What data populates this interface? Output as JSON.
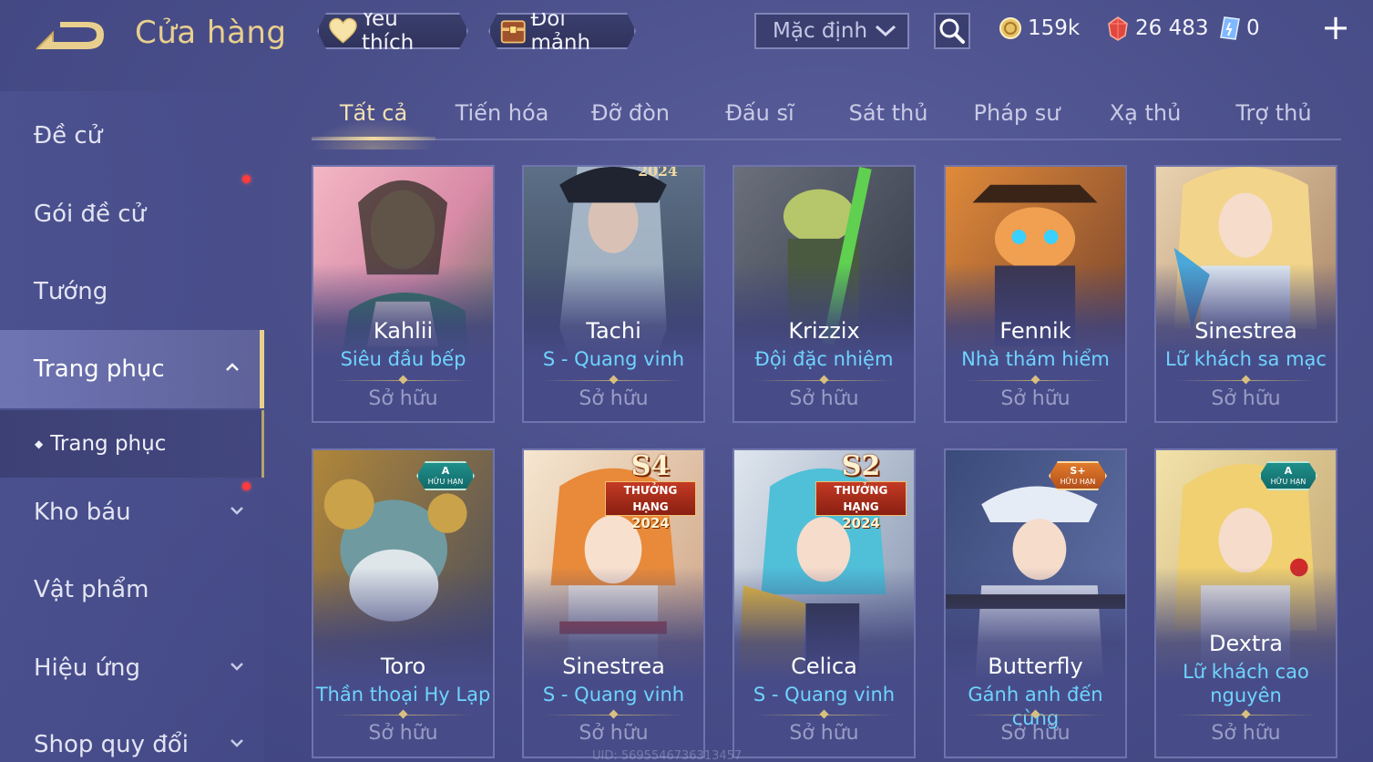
{
  "header": {
    "title": "Cửa hàng",
    "favorite_label": "Yêu thích",
    "exchange_label": "Đổi mảnh",
    "sort_value": "Mặc định",
    "currencies": {
      "gold": "159k",
      "gems": "26 483",
      "tickets": "0"
    }
  },
  "sidebar": {
    "items": [
      {
        "label": "Đề cử"
      },
      {
        "label": "Gói đề cử"
      },
      {
        "label": "Tướng"
      },
      {
        "label": "Trang phục"
      },
      {
        "label": "Trang phục"
      },
      {
        "label": "Kho báu"
      },
      {
        "label": "Vật phẩm"
      },
      {
        "label": "Hiệu ứng"
      },
      {
        "label": "Shop quy đổi"
      }
    ]
  },
  "tabs": [
    "Tất cả",
    "Tiến hóa",
    "Đỡ đòn",
    "Đấu sĩ",
    "Sát thủ",
    "Pháp sư",
    "Xạ thủ",
    "Trợ thủ"
  ],
  "cards": [
    {
      "hero": "Kahlii",
      "skin": "Siêu đầu bếp",
      "status": "Sở hữu"
    },
    {
      "hero": "Tachi",
      "skin": "S - Quang vinh",
      "status": "Sở hữu",
      "top_text": "2024"
    },
    {
      "hero": "Krizzix",
      "skin": "Đội đặc nhiệm",
      "status": "Sở hữu"
    },
    {
      "hero": "Fennik",
      "skin": "Nhà thám hiểm",
      "status": "Sở hữu"
    },
    {
      "hero": "Sinestrea",
      "skin": "Lữ khách sa mạc",
      "status": "Sở hữu"
    },
    {
      "hero": "Toro",
      "skin": "Thần thoại Hy Lạp",
      "status": "Sở hữu",
      "badge": "A",
      "badge_sub": "HỮU HẠN"
    },
    {
      "hero": "Sinestrea",
      "skin": "S - Quang vinh",
      "status": "Sở hữu",
      "season": "S4",
      "season_rib": "THƯỞNG HẠNG",
      "season_year": "2024"
    },
    {
      "hero": "Celica",
      "skin": "S - Quang vinh",
      "status": "Sở hữu",
      "season": "S2",
      "season_rib": "THƯỞNG HẠNG",
      "season_year": "2024"
    },
    {
      "hero": "Butterfly",
      "skin": "Gánh anh đến cùng",
      "status": "Sở hữu",
      "badge": "S+",
      "badge_sub": "HỮU HẠN"
    },
    {
      "hero": "Dextra",
      "skin": "Lữ khách cao nguyên",
      "status": "Sở hữu",
      "badge": "A",
      "badge_sub": "HỮU HẠN"
    }
  ],
  "footer": {
    "uid": "UID: 5695546736313457"
  },
  "colors": {
    "accent_gold": "#e9cf8e",
    "skin_name": "#6fd4ff",
    "background": "#4a4f8a",
    "notify": "#ff3b3b"
  },
  "icons": [
    "back-arrow-icon",
    "heart-icon",
    "chest-icon",
    "chevron-down-icon",
    "search-icon",
    "gold-coin-icon",
    "red-gem-icon",
    "ticket-icon",
    "plus-icon",
    "chevron-up-icon"
  ]
}
